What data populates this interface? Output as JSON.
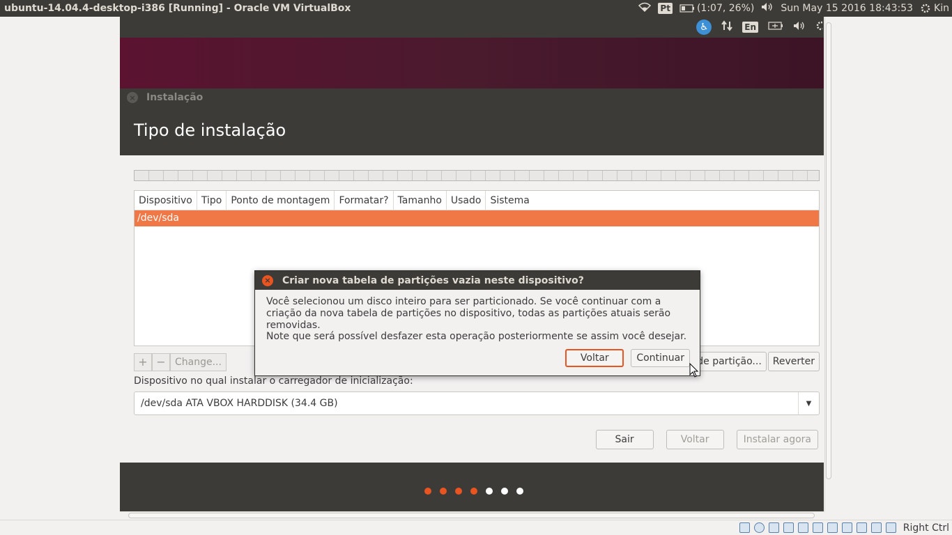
{
  "host_panel": {
    "title": "ubuntu-14.04.4-desktop-i386 [Running] - Oracle VM VirtualBox",
    "keyboard_layout": "Pt",
    "battery": "(1:07, 26%)",
    "datetime": "Sun May 15 2016 18:43:53",
    "user": "Kin",
    "icons": [
      "wifi-icon",
      "battery-icon",
      "volume-icon",
      "gear-icon"
    ]
  },
  "guest_panel": {
    "keyboard_layout": "En",
    "icons": [
      "accessibility-icon",
      "network-arrows-icon",
      "battery-icon",
      "volume-icon",
      "gear-icon"
    ]
  },
  "installer": {
    "window_title": "Instalação",
    "page_title": "Tipo de instalação",
    "table": {
      "columns": [
        "Dispositivo",
        "Tipo",
        "Ponto de montagem",
        "Formatar?",
        "Tamanho",
        "Usado",
        "Sistema"
      ],
      "rows": [
        {
          "device": "/dev/sda"
        }
      ]
    },
    "buttons": {
      "add": "+",
      "remove": "−",
      "change": "Change...",
      "new_partition_table": "de partição...",
      "revert": "Reverter"
    },
    "bootloader_label": "Dispositivo no qual instalar o carregador de inicialização:",
    "bootloader_value": "/dev/sda  ATA VBOX HARDDISK (34.4 GB)",
    "nav": {
      "quit": "Sair",
      "back": "Voltar",
      "install": "Instalar agora"
    },
    "progress_dots": {
      "total": 7,
      "completed": 4,
      "active_color": "#e95420",
      "inactive_color": "#ffffff"
    }
  },
  "dialog": {
    "title": "Criar nova tabela de partições vazia neste dispositivo?",
    "message": "Você selecionou um disco inteiro para ser particionado. Se você continuar com a criação da nova tabela de partições no dispositivo, todas as partições atuais serão removidas.",
    "note": "Note que será possível desfazer esta operação posteriormente se assim você desejar.",
    "back_label": "Voltar",
    "continue_label": "Continuar"
  },
  "statusbar": {
    "host_key": "Right Ctrl"
  },
  "colors": {
    "accent": "#e95420",
    "selection": "#f07746",
    "panel": "#3c3b37"
  }
}
